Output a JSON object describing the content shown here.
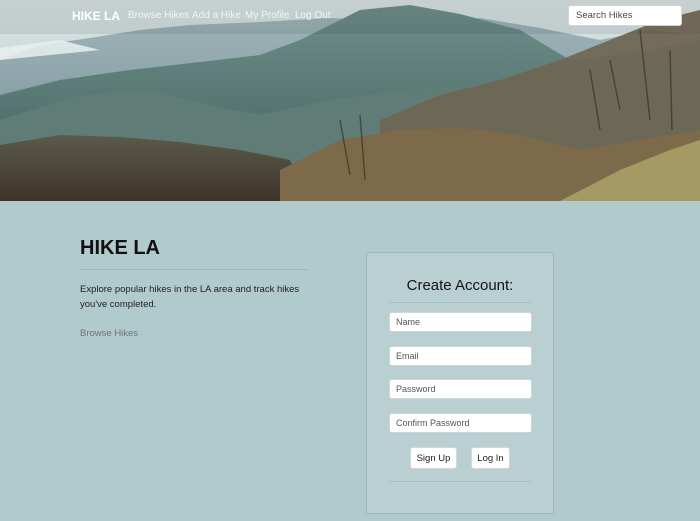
{
  "navbar": {
    "brand": "HIKE LA",
    "links": [
      "Browse Hikes",
      "Add a Hike",
      "My Profile",
      "Log Out"
    ],
    "search_placeholder": "Search Hikes"
  },
  "intro": {
    "title": "HIKE LA",
    "description": "Explore popular hikes in the LA area and track hikes you've completed.",
    "link": "Browse Hikes"
  },
  "signup": {
    "title": "Create Account:",
    "name_placeholder": "Name",
    "email_placeholder": "Email",
    "password_placeholder": "Password",
    "confirm_placeholder": "Confirm Password",
    "signup_label": "Sign Up",
    "login_label": "Log In"
  },
  "colors": {
    "page_background": "#b1cacb",
    "card_background": "#b9cfd2"
  }
}
